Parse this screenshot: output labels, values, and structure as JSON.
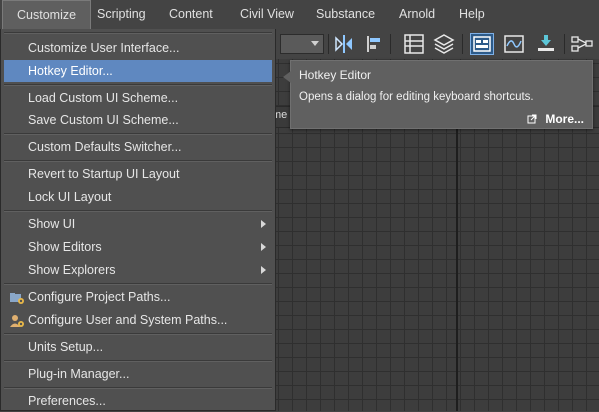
{
  "menubar": {
    "items": [
      {
        "label": "Customize",
        "active": true
      },
      {
        "label": "Scripting"
      },
      {
        "label": "Content"
      },
      {
        "label": "Civil View"
      },
      {
        "label": "Substance"
      },
      {
        "label": "Arnold"
      },
      {
        "label": "Help"
      }
    ]
  },
  "toolbar": {
    "buttons": [
      "mirror-icon",
      "align-icon",
      "layer-list-icon",
      "layer-stack-icon",
      "schematic-view-icon",
      "curve-editor-icon",
      "render-setup-icon",
      "node-graph-icon"
    ],
    "selected": "schematic-view-icon",
    "accent": "#2d5b8a"
  },
  "viewport": {
    "label_fragment": "me"
  },
  "menu": {
    "items": [
      {
        "label": "Customize User Interface...",
        "mnemonic": "C"
      },
      {
        "label": "Hotkey Editor...",
        "highlighted": true
      },
      {
        "label": "Load Custom UI Scheme..."
      },
      {
        "label": "Save Custom UI Scheme..."
      },
      {
        "label": "Custom Defaults Switcher..."
      },
      {
        "label": "Revert to Startup UI Layout"
      },
      {
        "label": "Lock UI Layout"
      },
      {
        "label": "Show UI",
        "submenu": true
      },
      {
        "label": "Show Editors",
        "submenu": true
      },
      {
        "label": "Show Explorers",
        "submenu": true
      },
      {
        "label": "Configure Project Paths...",
        "icon": "folder-gear-icon"
      },
      {
        "label": "Configure User and System Paths...",
        "icon": "user-gear-icon"
      },
      {
        "label": "Units Setup..."
      },
      {
        "label": "Plug-in Manager..."
      },
      {
        "label": "Preferences..."
      }
    ],
    "highlight_color": "#5f88c0"
  },
  "tooltip": {
    "title": "Hotkey Editor",
    "description": "Opens a dialog for editing keyboard shortcuts.",
    "more": "More..."
  }
}
